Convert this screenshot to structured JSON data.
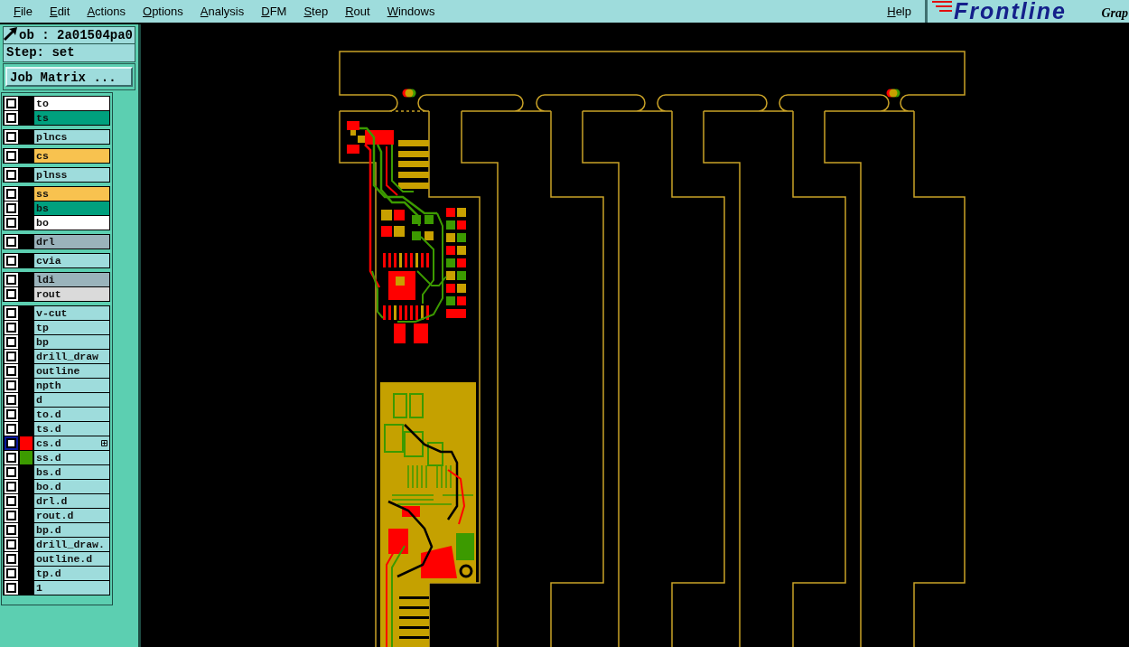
{
  "menu_bar": {
    "items": [
      "File",
      "Edit",
      "Actions",
      "Options",
      "Analysis",
      "DFM",
      "Step",
      "Rout",
      "Windows"
    ],
    "help": "Help"
  },
  "logo": {
    "text": "Frontline",
    "caption": "Grap"
  },
  "job_panel": {
    "job": "ob : 2a01504pa0",
    "step": "Step: set",
    "matrix_button": "Job Matrix ..."
  },
  "layer_groups": [
    {
      "layers": [
        {
          "name": "to",
          "color": "#ffffff",
          "checked": false,
          "selected": false,
          "plus_box": false
        },
        {
          "name": "ts",
          "color": "#00a07e",
          "checked": false,
          "selected": false,
          "plus_box": false
        }
      ]
    },
    {
      "layers": [
        {
          "name": "plncs",
          "color": "#9edcdc",
          "checked": false,
          "selected": false,
          "plus_box": false
        }
      ]
    },
    {
      "layers": [
        {
          "name": "cs",
          "color": "#f8c24f",
          "checked": false,
          "selected": false,
          "plus_box": false
        }
      ]
    },
    {
      "layers": [
        {
          "name": "plnss",
          "color": "#9edcdc",
          "checked": false,
          "selected": false,
          "plus_box": false
        }
      ]
    },
    {
      "layers": [
        {
          "name": "ss",
          "color": "#f8c24f",
          "checked": false,
          "selected": false,
          "plus_box": false
        },
        {
          "name": "bs",
          "color": "#00a07e",
          "checked": false,
          "selected": false,
          "plus_box": false
        },
        {
          "name": "bo",
          "color": "#ffffff",
          "checked": false,
          "selected": false,
          "plus_box": false
        }
      ]
    },
    {
      "layers": [
        {
          "name": "drl",
          "color": "#9ab3bb",
          "checked": false,
          "selected": false,
          "plus_box": false
        }
      ]
    },
    {
      "layers": [
        {
          "name": "cvia",
          "color": "#9edcdc",
          "checked": false,
          "selected": false,
          "plus_box": false
        }
      ]
    },
    {
      "layers": [
        {
          "name": "ldi",
          "color": "#9ab3bb",
          "checked": false,
          "selected": false,
          "plus_box": false
        },
        {
          "name": "rout",
          "color": "#dadada",
          "checked": false,
          "selected": false,
          "plus_box": false
        }
      ]
    },
    {
      "layers": [
        {
          "name": "v-cut",
          "color": "#9edcdc",
          "checked": false,
          "selected": false,
          "plus_box": false
        },
        {
          "name": "tp",
          "color": "#9edcdc",
          "checked": false,
          "selected": false,
          "plus_box": false
        },
        {
          "name": "bp",
          "color": "#9edcdc",
          "checked": false,
          "selected": false,
          "plus_box": false
        },
        {
          "name": "drill_draw",
          "color": "#9edcdc",
          "checked": false,
          "selected": false,
          "plus_box": false
        },
        {
          "name": "outline",
          "color": "#9edcdc",
          "checked": false,
          "selected": false,
          "plus_box": false
        },
        {
          "name": "npth",
          "color": "#9edcdc",
          "checked": false,
          "selected": false,
          "plus_box": false
        },
        {
          "name": "d",
          "color": "#9edcdc",
          "checked": false,
          "selected": false,
          "plus_box": false
        },
        {
          "name": "to.d",
          "color": "#9edcdc",
          "checked": false,
          "selected": false,
          "plus_box": false
        },
        {
          "name": "ts.d",
          "color": "#9edcdc",
          "checked": false,
          "selected": false,
          "plus_box": false
        },
        {
          "name": "cs.d",
          "color": "#9edcdc",
          "checked": false,
          "selected": true,
          "plus_box": true,
          "swatch": {
            "color": "#ff0000"
          }
        },
        {
          "name": "ss.d",
          "color": "#9edcdc",
          "checked": false,
          "selected": false,
          "plus_box": false,
          "swatch": {
            "color": "#3c9a00"
          }
        },
        {
          "name": "bs.d",
          "color": "#9edcdc",
          "checked": false,
          "selected": false,
          "plus_box": false
        },
        {
          "name": "bo.d",
          "color": "#9edcdc",
          "checked": false,
          "selected": false,
          "plus_box": false
        },
        {
          "name": "drl.d",
          "color": "#9edcdc",
          "checked": false,
          "selected": false,
          "plus_box": false
        },
        {
          "name": "rout.d",
          "color": "#9edcdc",
          "checked": false,
          "selected": false,
          "plus_box": false
        },
        {
          "name": "bp.d",
          "color": "#9edcdc",
          "checked": false,
          "selected": false,
          "plus_box": false
        },
        {
          "name": "drill_draw.",
          "color": "#9edcdc",
          "checked": false,
          "selected": false,
          "plus_box": false
        },
        {
          "name": "outline.d",
          "color": "#9edcdc",
          "checked": false,
          "selected": false,
          "plus_box": false
        },
        {
          "name": "tp.d",
          "color": "#9edcdc",
          "checked": false,
          "selected": false,
          "plus_box": false
        },
        {
          "name": "1",
          "color": "#9edcdc",
          "checked": false,
          "selected": false,
          "plus_box": false
        }
      ]
    }
  ]
}
